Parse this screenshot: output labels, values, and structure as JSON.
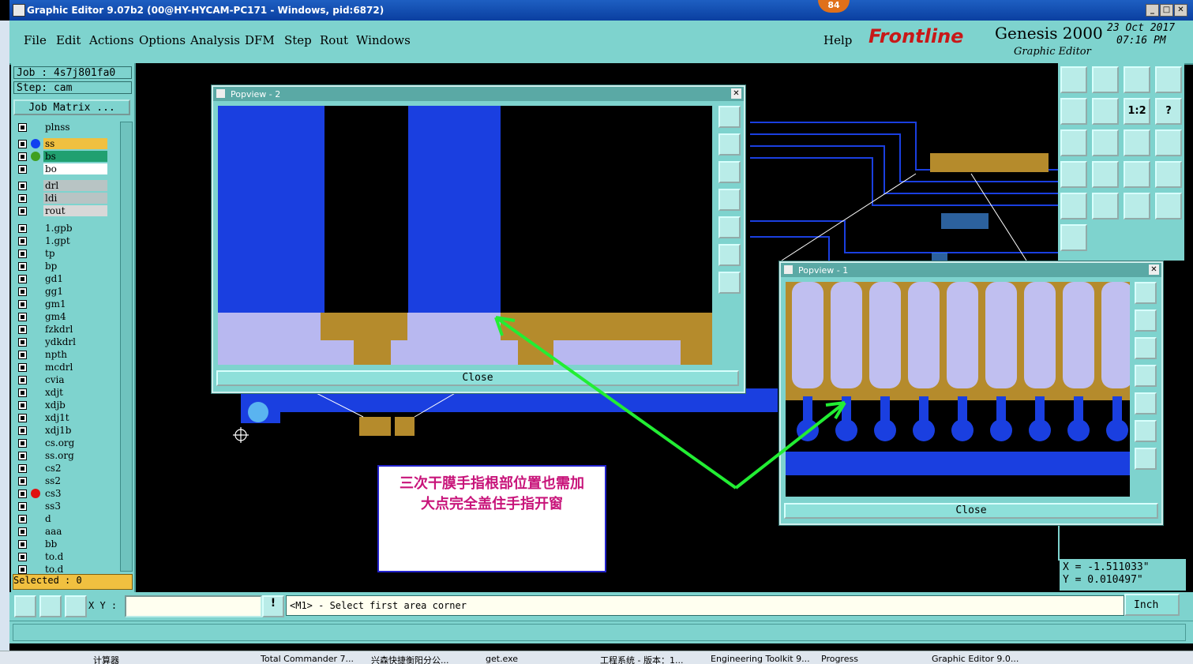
{
  "window": {
    "title": "Graphic Editor 9.07b2 (00@HY-HYCAM-PC171 - Windows, pid:6872)",
    "badge": "84"
  },
  "menu": [
    "File",
    "Edit",
    "Actions",
    "Options",
    "Analysis",
    "DFM",
    "Step",
    "Rout",
    "Windows"
  ],
  "help": "Help",
  "brand": {
    "logo": "Frontline",
    "product": "Genesis 2000",
    "sub": "Graphic Editor",
    "date": "23 Oct 2017",
    "time": "07:16 PM"
  },
  "job": {
    "job_label": "Job : 4s7j801fa0",
    "step_label": "Step: cam",
    "matrix_button": "Job Matrix ..."
  },
  "layers": [
    {
      "name": "plnss",
      "bg": "#7ed3ce",
      "dot": ""
    },
    {
      "name": "ss",
      "bg": "#f0c040",
      "dot": "#1040f0"
    },
    {
      "name": "bs",
      "bg": "#20a070",
      "dot": "#40a020"
    },
    {
      "name": "bo",
      "bg": "#ffffff",
      "dot": ""
    },
    {
      "name": "drl",
      "bg": "#b8c4c4",
      "dot": ""
    },
    {
      "name": "ldi",
      "bg": "#b8c4c4",
      "dot": ""
    },
    {
      "name": "rout",
      "bg": "#d8d8d8",
      "dot": ""
    },
    {
      "name": "1.gpb",
      "bg": "#7ed3ce",
      "dot": ""
    },
    {
      "name": "1.gpt",
      "bg": "#7ed3ce",
      "dot": ""
    },
    {
      "name": "tp",
      "bg": "#7ed3ce",
      "dot": ""
    },
    {
      "name": "bp",
      "bg": "#7ed3ce",
      "dot": ""
    },
    {
      "name": "gd1",
      "bg": "#7ed3ce",
      "dot": ""
    },
    {
      "name": "gg1",
      "bg": "#7ed3ce",
      "dot": ""
    },
    {
      "name": "gm1",
      "bg": "#7ed3ce",
      "dot": ""
    },
    {
      "name": "gm4",
      "bg": "#7ed3ce",
      "dot": ""
    },
    {
      "name": "fzkdrl",
      "bg": "#7ed3ce",
      "dot": ""
    },
    {
      "name": "ydkdrl",
      "bg": "#7ed3ce",
      "dot": ""
    },
    {
      "name": "npth",
      "bg": "#7ed3ce",
      "dot": ""
    },
    {
      "name": "mcdrl",
      "bg": "#7ed3ce",
      "dot": ""
    },
    {
      "name": "cvia",
      "bg": "#7ed3ce",
      "dot": ""
    },
    {
      "name": "xdjt",
      "bg": "#7ed3ce",
      "dot": ""
    },
    {
      "name": "xdjb",
      "bg": "#7ed3ce",
      "dot": ""
    },
    {
      "name": "xdj1t",
      "bg": "#7ed3ce",
      "dot": ""
    },
    {
      "name": "xdj1b",
      "bg": "#7ed3ce",
      "dot": ""
    },
    {
      "name": "cs.org",
      "bg": "#7ed3ce",
      "dot": ""
    },
    {
      "name": "ss.org",
      "bg": "#7ed3ce",
      "dot": ""
    },
    {
      "name": "cs2",
      "bg": "#7ed3ce",
      "dot": ""
    },
    {
      "name": "ss2",
      "bg": "#7ed3ce",
      "dot": ""
    },
    {
      "name": "cs3",
      "bg": "#7ed3ce",
      "dot": "#e01010"
    },
    {
      "name": "ss3",
      "bg": "#7ed3ce",
      "dot": ""
    },
    {
      "name": "d",
      "bg": "#7ed3ce",
      "dot": ""
    },
    {
      "name": "aaa",
      "bg": "#7ed3ce",
      "dot": ""
    },
    {
      "name": "bb",
      "bg": "#7ed3ce",
      "dot": ""
    },
    {
      "name": "to.d",
      "bg": "#7ed3ce",
      "dot": ""
    },
    {
      "name": "to.d",
      "bg": "#7ed3ce",
      "dot": ""
    }
  ],
  "selected": "Selected : 0",
  "popview2": {
    "title": "Popview - 2",
    "close": "Close"
  },
  "popview1": {
    "title": "Popview - 1",
    "close": "Close"
  },
  "note": {
    "line1": "三次干膜手指根部位置也需加",
    "line2": "大点完全盖住手指开窗"
  },
  "coords": {
    "x": "X = -1.511033\"",
    "y": "Y =  0.010497\""
  },
  "toolgrid": [
    "",
    "",
    "",
    "",
    "",
    "",
    "1:2",
    "?",
    "",
    "",
    "",
    "",
    "",
    "",
    "",
    "",
    "",
    "",
    "",
    "",
    ""
  ],
  "bottom": {
    "xy_label": "X Y :",
    "xy_value": "",
    "prompt": "<M1> - Select first area corner",
    "unit": "Inch"
  },
  "taskbar": [
    "计算器",
    "Total Commander 7...",
    "兴森快捷衡阳分公...",
    "get.exe",
    "工程系统 - 版本：1...",
    "Engineering Toolkit 9...",
    "Progress",
    "Graphic Editor 9.0..."
  ]
}
